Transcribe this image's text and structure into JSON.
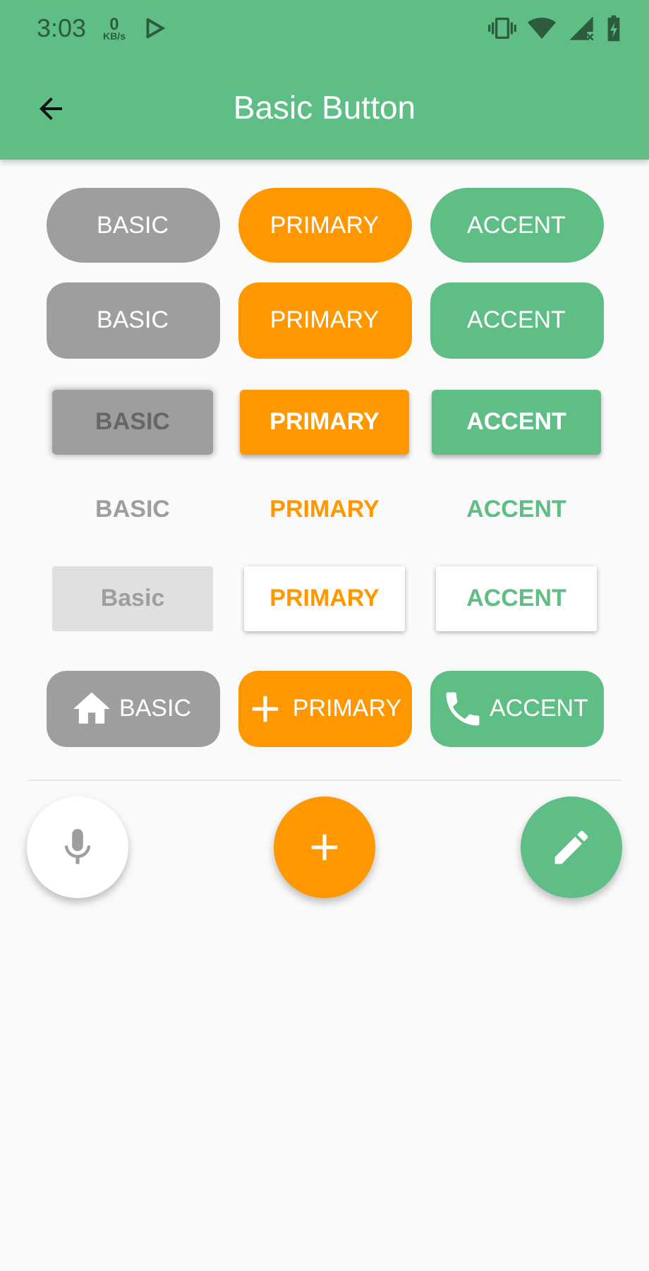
{
  "status_bar": {
    "time": "3:03",
    "speed_value": "0",
    "speed_unit": "KB/s"
  },
  "app_bar": {
    "title": "Basic Button"
  },
  "button_rows": [
    {
      "kind": "pill",
      "buttons": [
        {
          "color": "#9e9e9e",
          "label": "BASIC"
        },
        {
          "color": "#ff9800",
          "label": "PRIMARY"
        },
        {
          "color": "#5fbd86",
          "label": "ACCENT"
        }
      ]
    },
    {
      "kind": "rounded",
      "buttons": [
        {
          "color": "#9e9e9e",
          "label": "BASIC"
        },
        {
          "color": "#ff9800",
          "label": "PRIMARY"
        },
        {
          "color": "#5fbd86",
          "label": "ACCENT"
        }
      ]
    },
    {
      "kind": "raised",
      "buttons": [
        {
          "color": "#9e9e9e",
          "label": "BASIC",
          "disabled": true
        },
        {
          "color": "#ff9800",
          "label": "PRIMARY",
          "disabled": false
        },
        {
          "color": "#5fbd86",
          "label": "ACCENT",
          "disabled": false
        }
      ]
    },
    {
      "kind": "flat",
      "buttons": [
        {
          "color": "#9e9e9e",
          "label": "BASIC"
        },
        {
          "color": "#ff9800",
          "label": "PRIMARY"
        },
        {
          "color": "#5fbd86",
          "label": "ACCENT"
        }
      ]
    },
    {
      "kind": "stroked",
      "buttons": [
        {
          "color": "#9e9e9e",
          "label": "Basic",
          "disabled": true
        },
        {
          "color": "#ff9800",
          "label": "PRIMARY",
          "disabled": false
        },
        {
          "color": "#5fbd86",
          "label": "ACCENT",
          "disabled": false
        }
      ]
    },
    {
      "kind": "icon",
      "buttons": [
        {
          "color": "#9e9e9e",
          "label": "BASIC"
        },
        {
          "color": "#ff9800",
          "label": "PRIMARY"
        },
        {
          "color": "#5fbd86",
          "label": "ACCENT"
        }
      ]
    }
  ],
  "fabs": [
    {
      "color": "#ffffff"
    },
    {
      "color": "#ff9800"
    },
    {
      "color": "#5fbd86"
    }
  ]
}
